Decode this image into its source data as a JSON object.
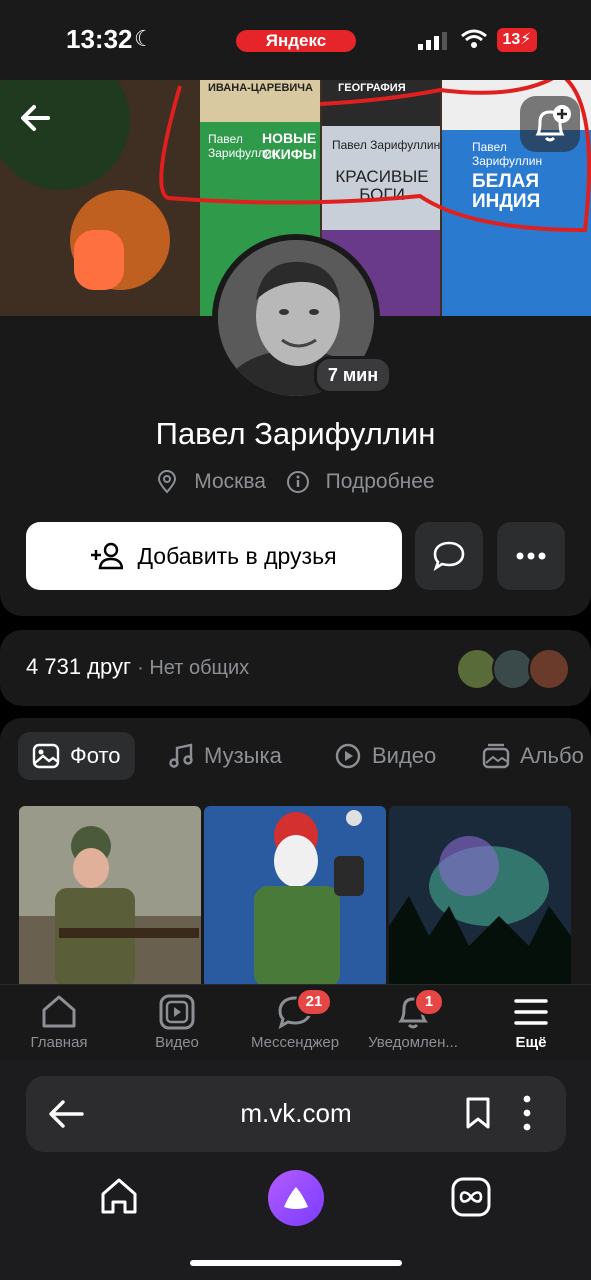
{
  "status_bar": {
    "time": "13:32",
    "browser_label": "Яндекс",
    "battery": "13"
  },
  "cover": {
    "books": [
      "ИВАНА-ЦАРЕВИЧА",
      "ГЕОГРАФИЯ",
      "Павел Зарифуллин",
      "НОВЫЕ СКИФЫ",
      "Павел Зарифуллин",
      "КРАСИВЫЕ БОГИ",
      "Павел Зарифуллин",
      "БЕЛАЯ ИНДИЯ"
    ],
    "annotation_color": "#e0201e"
  },
  "profile": {
    "last_seen": "7 мин",
    "name": "Павел Зарифуллин",
    "city": "Москва",
    "more": "Подробнее",
    "add_friend_label": "Добавить в друзья"
  },
  "friends": {
    "count": "4 731 друг",
    "mutual": "· Нет общих"
  },
  "media_tabs": [
    {
      "label": "Фото",
      "icon": "image-icon",
      "active": true
    },
    {
      "label": "Музыка",
      "icon": "music-note-icon",
      "active": false
    },
    {
      "label": "Видео",
      "icon": "play-circle-icon",
      "active": false
    },
    {
      "label": "Альбо",
      "icon": "album-icon",
      "active": false
    }
  ],
  "bottom_nav": [
    {
      "label": "Главная",
      "icon": "home-icon"
    },
    {
      "label": "Видео",
      "icon": "video-icon"
    },
    {
      "label": "Мессенджер",
      "icon": "chat-icon",
      "badge": "21"
    },
    {
      "label": "Уведомлен...",
      "icon": "bell-icon",
      "badge": "1"
    },
    {
      "label": "Ещё",
      "icon": "menu-icon",
      "active": true
    }
  ],
  "browser": {
    "url": "m.vk.com"
  }
}
